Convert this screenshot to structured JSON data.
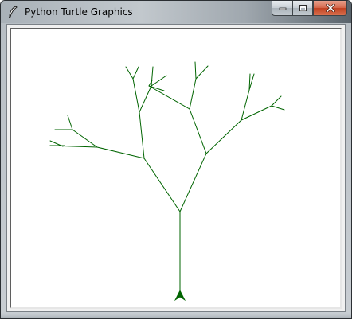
{
  "window": {
    "title": "Python Turtle Graphics",
    "app_icon": "feather-quill-icon"
  },
  "caption_buttons": {
    "minimize_icon": "minimize-icon",
    "maximize_icon": "maximize-icon",
    "close_icon": "close-icon"
  },
  "canvas": {
    "background": "#ffffff",
    "pen_color": "#006400",
    "turtle_color": "#006400",
    "turtle_icon": "turtle-arrow-icon"
  }
}
